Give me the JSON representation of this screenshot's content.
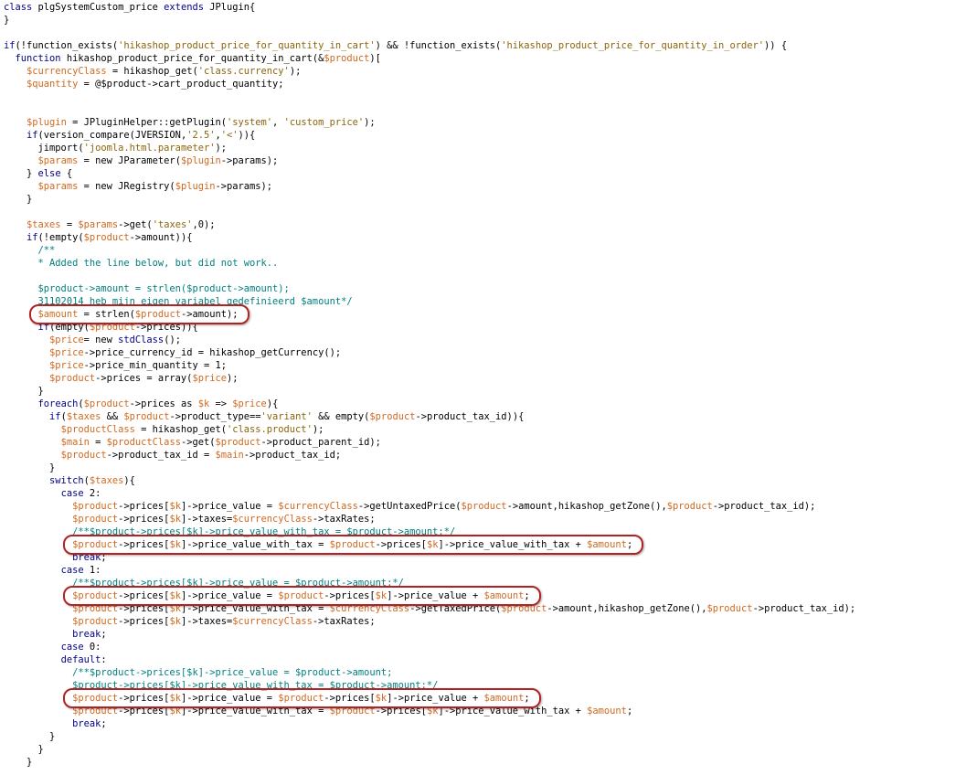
{
  "editor": {
    "lines": [
      [
        [
          "kw",
          "class"
        ],
        [
          "pln",
          " plgSystemCustom_price "
        ],
        [
          "kw",
          "extends"
        ],
        [
          "pln",
          " JPlugin{"
        ]
      ],
      [
        [
          "pln",
          "}"
        ]
      ],
      [],
      [
        [
          "kw",
          "if"
        ],
        [
          "pln",
          "(!function_exists("
        ],
        [
          "str",
          "'hikashop_product_price_for_quantity_in_cart'"
        ],
        [
          "pln",
          ") && !function_exists("
        ],
        [
          "str",
          "'hikashop_product_price_for_quantity_in_order'"
        ],
        [
          "pln",
          ")) {"
        ]
      ],
      [
        [
          "pln",
          "  "
        ],
        [
          "kw",
          "function"
        ],
        [
          "pln",
          " hikashop_product_price_for_quantity_in_cart(&"
        ],
        [
          "var",
          "$product"
        ],
        [
          "pln",
          ")["
        ]
      ],
      [
        [
          "pln",
          "    "
        ],
        [
          "var",
          "$currencyClass"
        ],
        [
          "pln",
          " = hikashop_get("
        ],
        [
          "str",
          "'class.currency'"
        ],
        [
          "pln",
          ");"
        ]
      ],
      [
        [
          "pln",
          "    "
        ],
        [
          "var",
          "$quantity"
        ],
        [
          "pln",
          " = @$product->cart_product_quantity;"
        ]
      ],
      [],
      [],
      [
        [
          "pln",
          "    "
        ],
        [
          "var",
          "$plugin"
        ],
        [
          "pln",
          " = JPluginHelper::getPlugin("
        ],
        [
          "str",
          "'system'"
        ],
        [
          "pln",
          ", "
        ],
        [
          "str",
          "'custom_price'"
        ],
        [
          "pln",
          ");"
        ]
      ],
      [
        [
          "pln",
          "    "
        ],
        [
          "kw",
          "if"
        ],
        [
          "pln",
          "(version_compare(JVERSION,"
        ],
        [
          "str",
          "'2.5'"
        ],
        [
          "pln",
          ","
        ],
        [
          "str",
          "'<'"
        ],
        [
          "pln",
          ")){"
        ]
      ],
      [
        [
          "pln",
          "      jimport("
        ],
        [
          "str",
          "'joomla.html.parameter'"
        ],
        [
          "pln",
          ");"
        ]
      ],
      [
        [
          "pln",
          "      "
        ],
        [
          "var",
          "$params"
        ],
        [
          "pln",
          " = new JParameter("
        ],
        [
          "var",
          "$plugin"
        ],
        [
          "pln",
          "->params);"
        ]
      ],
      [
        [
          "pln",
          "    } "
        ],
        [
          "kw",
          "else"
        ],
        [
          "pln",
          " {"
        ]
      ],
      [
        [
          "pln",
          "      "
        ],
        [
          "var",
          "$params"
        ],
        [
          "pln",
          " = new JRegistry("
        ],
        [
          "var",
          "$plugin"
        ],
        [
          "pln",
          "->params);"
        ]
      ],
      [
        [
          "pln",
          "    }"
        ]
      ],
      [],
      [
        [
          "pln",
          "    "
        ],
        [
          "var",
          "$taxes"
        ],
        [
          "pln",
          " = "
        ],
        [
          "var",
          "$params"
        ],
        [
          "pln",
          "->get("
        ],
        [
          "str",
          "'taxes'"
        ],
        [
          "pln",
          ",0);"
        ]
      ],
      [
        [
          "pln",
          "    "
        ],
        [
          "kw",
          "if"
        ],
        [
          "pln",
          "(!empty("
        ],
        [
          "var",
          "$product"
        ],
        [
          "pln",
          "->amount)){"
        ]
      ],
      [
        [
          "cmt",
          "      /**"
        ]
      ],
      [
        [
          "cmt",
          "      * Added the line below, but did not work.."
        ]
      ],
      [],
      [
        [
          "cmt",
          "      $product->amount = strlen($product->amount);"
        ]
      ],
      [
        [
          "cmt",
          "      31102014 heb mijn eigen variabel gedefinieerd $amount*/"
        ]
      ],
      [
        [
          "pln",
          "      "
        ],
        [
          "var",
          "$amount"
        ],
        [
          "pln",
          " = strlen("
        ],
        [
          "var",
          "$product"
        ],
        [
          "pln",
          "->amount);"
        ]
      ],
      [
        [
          "pln",
          "      "
        ],
        [
          "kw",
          "if"
        ],
        [
          "pln",
          "(empty("
        ],
        [
          "var",
          "$product"
        ],
        [
          "pln",
          "->prices)){"
        ]
      ],
      [
        [
          "pln",
          "        "
        ],
        [
          "var",
          "$price"
        ],
        [
          "pln",
          "= new "
        ],
        [
          "kw",
          "stdClass"
        ],
        [
          "pln",
          "();"
        ]
      ],
      [
        [
          "pln",
          "        "
        ],
        [
          "var",
          "$price"
        ],
        [
          "pln",
          "->price_currency_id = hikashop_getCurrency();"
        ]
      ],
      [
        [
          "pln",
          "        "
        ],
        [
          "var",
          "$price"
        ],
        [
          "pln",
          "->price_min_quantity = 1;"
        ]
      ],
      [
        [
          "pln",
          "        "
        ],
        [
          "var",
          "$product"
        ],
        [
          "pln",
          "->prices = array("
        ],
        [
          "var",
          "$price"
        ],
        [
          "pln",
          ");"
        ]
      ],
      [
        [
          "pln",
          "      }"
        ]
      ],
      [
        [
          "pln",
          "      "
        ],
        [
          "kw",
          "foreach"
        ],
        [
          "pln",
          "("
        ],
        [
          "var",
          "$product"
        ],
        [
          "pln",
          "->prices as "
        ],
        [
          "var",
          "$k"
        ],
        [
          "pln",
          " => "
        ],
        [
          "var",
          "$price"
        ],
        [
          "pln",
          "){"
        ]
      ],
      [
        [
          "pln",
          "        "
        ],
        [
          "kw",
          "if"
        ],
        [
          "pln",
          "("
        ],
        [
          "var",
          "$taxes"
        ],
        [
          "pln",
          " && "
        ],
        [
          "var",
          "$product"
        ],
        [
          "pln",
          "->product_type=="
        ],
        [
          "str",
          "'variant'"
        ],
        [
          "pln",
          " && empty("
        ],
        [
          "var",
          "$product"
        ],
        [
          "pln",
          "->product_tax_id)){"
        ]
      ],
      [
        [
          "pln",
          "          "
        ],
        [
          "var",
          "$productClass"
        ],
        [
          "pln",
          " = hikashop_get("
        ],
        [
          "str",
          "'class.product'"
        ],
        [
          "pln",
          ");"
        ]
      ],
      [
        [
          "pln",
          "          "
        ],
        [
          "var",
          "$main"
        ],
        [
          "pln",
          " = "
        ],
        [
          "var",
          "$productClass"
        ],
        [
          "pln",
          "->get("
        ],
        [
          "var",
          "$product"
        ],
        [
          "pln",
          "->product_parent_id);"
        ]
      ],
      [
        [
          "pln",
          "          "
        ],
        [
          "var",
          "$product"
        ],
        [
          "pln",
          "->product_tax_id = "
        ],
        [
          "var",
          "$main"
        ],
        [
          "pln",
          "->product_tax_id;"
        ]
      ],
      [
        [
          "pln",
          "        }"
        ]
      ],
      [
        [
          "pln",
          "        "
        ],
        [
          "kw",
          "switch"
        ],
        [
          "pln",
          "("
        ],
        [
          "var",
          "$taxes"
        ],
        [
          "pln",
          "){"
        ]
      ],
      [
        [
          "pln",
          "          "
        ],
        [
          "kw",
          "case"
        ],
        [
          "pln",
          " 2:"
        ]
      ],
      [
        [
          "pln",
          "            "
        ],
        [
          "var",
          "$product"
        ],
        [
          "pln",
          "->prices["
        ],
        [
          "var",
          "$k"
        ],
        [
          "pln",
          "]->price_value = "
        ],
        [
          "var",
          "$currencyClass"
        ],
        [
          "pln",
          "->getUntaxedPrice("
        ],
        [
          "var",
          "$product"
        ],
        [
          "pln",
          "->amount,hikashop_getZone(),"
        ],
        [
          "var",
          "$product"
        ],
        [
          "pln",
          "->product_tax_id);"
        ]
      ],
      [
        [
          "pln",
          "            "
        ],
        [
          "var",
          "$product"
        ],
        [
          "pln",
          "->prices["
        ],
        [
          "var",
          "$k"
        ],
        [
          "pln",
          "]->taxes="
        ],
        [
          "var",
          "$currencyClass"
        ],
        [
          "pln",
          "->taxRates;"
        ]
      ],
      [
        [
          "cmt",
          "            /**$product->prices[$k]->price_value_with_tax = $product->amount;*/"
        ]
      ],
      [
        [
          "pln",
          "            "
        ],
        [
          "var",
          "$product"
        ],
        [
          "pln",
          "->prices["
        ],
        [
          "var",
          "$k"
        ],
        [
          "pln",
          "]->price_value_with_tax = "
        ],
        [
          "var",
          "$product"
        ],
        [
          "pln",
          "->prices["
        ],
        [
          "var",
          "$k"
        ],
        [
          "pln",
          "]->price_value_with_tax + "
        ],
        [
          "var",
          "$amount"
        ],
        [
          "pln",
          ";"
        ]
      ],
      [
        [
          "pln",
          "            "
        ],
        [
          "kw",
          "break"
        ],
        [
          "pln",
          ";"
        ]
      ],
      [
        [
          "pln",
          "          "
        ],
        [
          "kw",
          "case"
        ],
        [
          "pln",
          " 1:"
        ]
      ],
      [
        [
          "cmt",
          "            /**$product->prices[$k]->price_value = $product->amount;*/"
        ]
      ],
      [
        [
          "pln",
          "            "
        ],
        [
          "var",
          "$product"
        ],
        [
          "pln",
          "->prices["
        ],
        [
          "var",
          "$k"
        ],
        [
          "pln",
          "]->price_value = "
        ],
        [
          "var",
          "$product"
        ],
        [
          "pln",
          "->prices["
        ],
        [
          "var",
          "$k"
        ],
        [
          "pln",
          "]->price_value + "
        ],
        [
          "var",
          "$amount"
        ],
        [
          "pln",
          ";"
        ]
      ],
      [
        [
          "pln",
          "            "
        ],
        [
          "var",
          "$product"
        ],
        [
          "pln",
          "->prices["
        ],
        [
          "var",
          "$k"
        ],
        [
          "pln",
          "]->price_value_with_tax = "
        ],
        [
          "var",
          "$currencyClass"
        ],
        [
          "pln",
          "->getTaxedPrice("
        ],
        [
          "var",
          "$product"
        ],
        [
          "pln",
          "->amount,hikashop_getZone(),"
        ],
        [
          "var",
          "$product"
        ],
        [
          "pln",
          "->product_tax_id);"
        ]
      ],
      [
        [
          "pln",
          "            "
        ],
        [
          "var",
          "$product"
        ],
        [
          "pln",
          "->prices["
        ],
        [
          "var",
          "$k"
        ],
        [
          "pln",
          "]->taxes="
        ],
        [
          "var",
          "$currencyClass"
        ],
        [
          "pln",
          "->taxRates;"
        ]
      ],
      [
        [
          "pln",
          "            "
        ],
        [
          "kw",
          "break"
        ],
        [
          "pln",
          ";"
        ]
      ],
      [
        [
          "pln",
          "          "
        ],
        [
          "kw",
          "case"
        ],
        [
          "pln",
          " 0:"
        ]
      ],
      [
        [
          "pln",
          "          "
        ],
        [
          "kw",
          "default"
        ],
        [
          "pln",
          ":"
        ]
      ],
      [
        [
          "cmt",
          "            /**$product->prices[$k]->price_value = $product->amount;"
        ]
      ],
      [
        [
          "cmt",
          "            $product->prices[$k]->price_value_with_tax = $product->amount;*/"
        ]
      ],
      [
        [
          "pln",
          "            "
        ],
        [
          "var",
          "$product"
        ],
        [
          "pln",
          "->prices["
        ],
        [
          "var",
          "$k"
        ],
        [
          "pln",
          "]->price_value = "
        ],
        [
          "var",
          "$product"
        ],
        [
          "pln",
          "->prices["
        ],
        [
          "var",
          "$k"
        ],
        [
          "pln",
          "]->price_value + "
        ],
        [
          "var",
          "$amount"
        ],
        [
          "pln",
          ";"
        ]
      ],
      [
        [
          "pln",
          "            "
        ],
        [
          "var",
          "$product"
        ],
        [
          "pln",
          "->prices["
        ],
        [
          "var",
          "$k"
        ],
        [
          "pln",
          "]->price_value_with_tax = "
        ],
        [
          "var",
          "$product"
        ],
        [
          "pln",
          "->prices["
        ],
        [
          "var",
          "$k"
        ],
        [
          "pln",
          "]->price_value_with_tax + "
        ],
        [
          "var",
          "$amount"
        ],
        [
          "pln",
          ";"
        ]
      ],
      [
        [
          "pln",
          "            "
        ],
        [
          "kw",
          "break"
        ],
        [
          "pln",
          ";"
        ]
      ],
      [
        [
          "pln",
          "        }"
        ]
      ],
      [
        [
          "pln",
          "      }"
        ]
      ],
      [
        [
          "pln",
          "    }"
        ]
      ]
    ],
    "highlighted_lines": [
      24,
      42,
      46,
      54
    ]
  }
}
